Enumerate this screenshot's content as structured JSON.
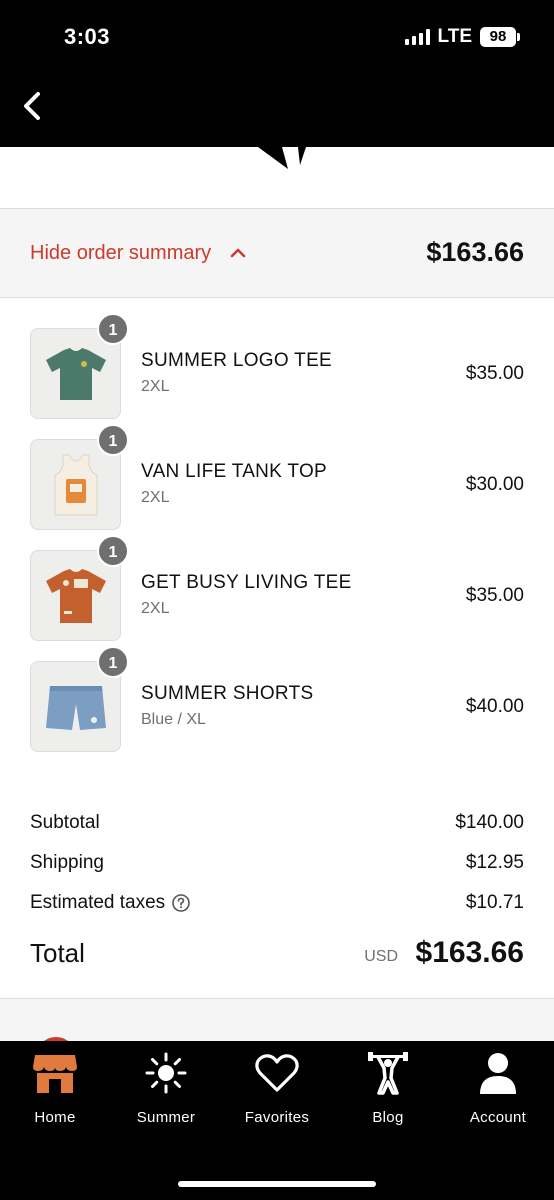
{
  "status_bar": {
    "time": "3:03",
    "network": "LTE",
    "battery": "98"
  },
  "order_summary": {
    "toggle_label": "Hide order summary",
    "total": "$163.66"
  },
  "items": [
    {
      "quantity": "1",
      "name": "SUMMER LOGO TEE",
      "variant": "2XL",
      "price": "$35.00",
      "image": "green-tshirt"
    },
    {
      "quantity": "1",
      "name": "VAN LIFE TANK TOP",
      "variant": "2XL",
      "price": "$30.00",
      "image": "cream-tank-top"
    },
    {
      "quantity": "1",
      "name": "GET BUSY LIVING TEE",
      "variant": "2XL",
      "price": "$35.00",
      "image": "orange-tshirt"
    },
    {
      "quantity": "1",
      "name": "SUMMER SHORTS",
      "variant": "Blue / XL",
      "price": "$40.00",
      "image": "blue-shorts"
    }
  ],
  "totals": {
    "subtotal_label": "Subtotal",
    "subtotal": "$140.00",
    "shipping_label": "Shipping",
    "shipping": "$12.95",
    "taxes_label": "Estimated taxes",
    "taxes": "$10.71",
    "total_label": "Total",
    "currency": "USD",
    "total": "$163.66"
  },
  "bottom_nav": [
    {
      "label": "Home",
      "icon": "storefront-icon",
      "color": "#e07a3f"
    },
    {
      "label": "Summer",
      "icon": "sun-icon"
    },
    {
      "label": "Favorites",
      "icon": "heart-icon"
    },
    {
      "label": "Blog",
      "icon": "weightlifter-icon"
    },
    {
      "label": "Account",
      "icon": "person-icon"
    }
  ],
  "colors": {
    "accent": "#cc3a2b",
    "home_icon": "#e07a3f",
    "header_bg": "#000000"
  }
}
